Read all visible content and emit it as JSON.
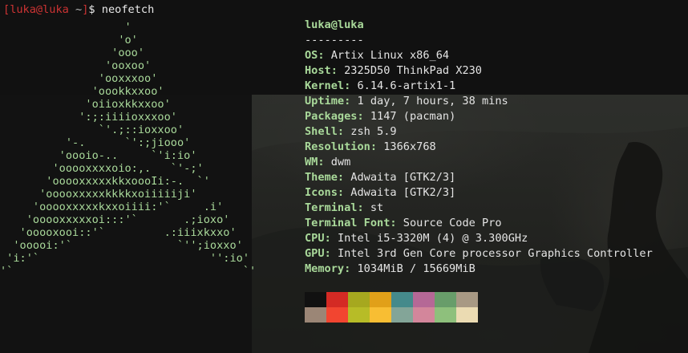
{
  "prompt": {
    "open_bracket": "[",
    "user_host": "luka@luka",
    "path": " ~",
    "close_bracket": "]",
    "symbol": "$ ",
    "command": "neofetch"
  },
  "ascii_logo": [
    "                   '",
    "                  'o'",
    "                 'ooo'",
    "                'ooxoo'",
    "               'ooxxxoo'",
    "              'oookkxxoo'",
    "             'oiioxkkxxoo'",
    "            ':;:iiiioxxxoo'",
    "               `'.;::ioxxoo'",
    "          '-.      `':;jiooo'",
    "         'oooio-..     `'i:io'",
    "        'ooooxxxxoio:,.   `'-;'",
    "       'ooooxxxxxkkxoooIi:-.  `'",
    "      'ooooxxxxxkkkkxoiiiiiji'",
    "     'ooooxxxxxkxxoiiii:'`     .i'",
    "    'ooooxxxxxoi:::'`       .;ioxo'",
    "   'ooooxooi::'`         .:iiixkxxo'",
    "  'ooooi:'`                `'';ioxxo'",
    " 'i:'`                          '':io'",
    "'`                                   `'"
  ],
  "info": {
    "title": "luka@luka",
    "separator": "---------",
    "rows": [
      {
        "label": "OS",
        "value": "Artix Linux x86_64"
      },
      {
        "label": "Host",
        "value": "2325D50 ThinkPad X230"
      },
      {
        "label": "Kernel",
        "value": "6.14.6-artix1-1"
      },
      {
        "label": "Uptime",
        "value": "1 day, 7 hours, 38 mins"
      },
      {
        "label": "Packages",
        "value": "1147 (pacman)"
      },
      {
        "label": "Shell",
        "value": "zsh 5.9"
      },
      {
        "label": "Resolution",
        "value": "1366x768"
      },
      {
        "label": "WM",
        "value": "dwm"
      },
      {
        "label": "Theme",
        "value": "Adwaita [GTK2/3]"
      },
      {
        "label": "Icons",
        "value": "Adwaita [GTK2/3]"
      },
      {
        "label": "Terminal",
        "value": "st"
      },
      {
        "label": "Terminal Font",
        "value": "Source Code Pro"
      },
      {
        "label": "CPU",
        "value": "Intel i5-3320M (4) @ 3.300GHz"
      },
      {
        "label": "GPU",
        "value": "Intel 3rd Gen Core processor Graphics Controller"
      },
      {
        "label": "Memory",
        "value": "1034MiB / 15669MiB"
      }
    ]
  },
  "palette": {
    "normal": [
      "#111111",
      "#d42a24",
      "#a6a81f",
      "#e1a019",
      "#458a8b",
      "#b56896",
      "#689d6a",
      "#a89984"
    ],
    "bright": [
      "#9b8676",
      "#f24530",
      "#b7bc27",
      "#f8be33",
      "#83a598",
      "#d3869b",
      "#8ec07c",
      "#ebdbb2"
    ]
  }
}
